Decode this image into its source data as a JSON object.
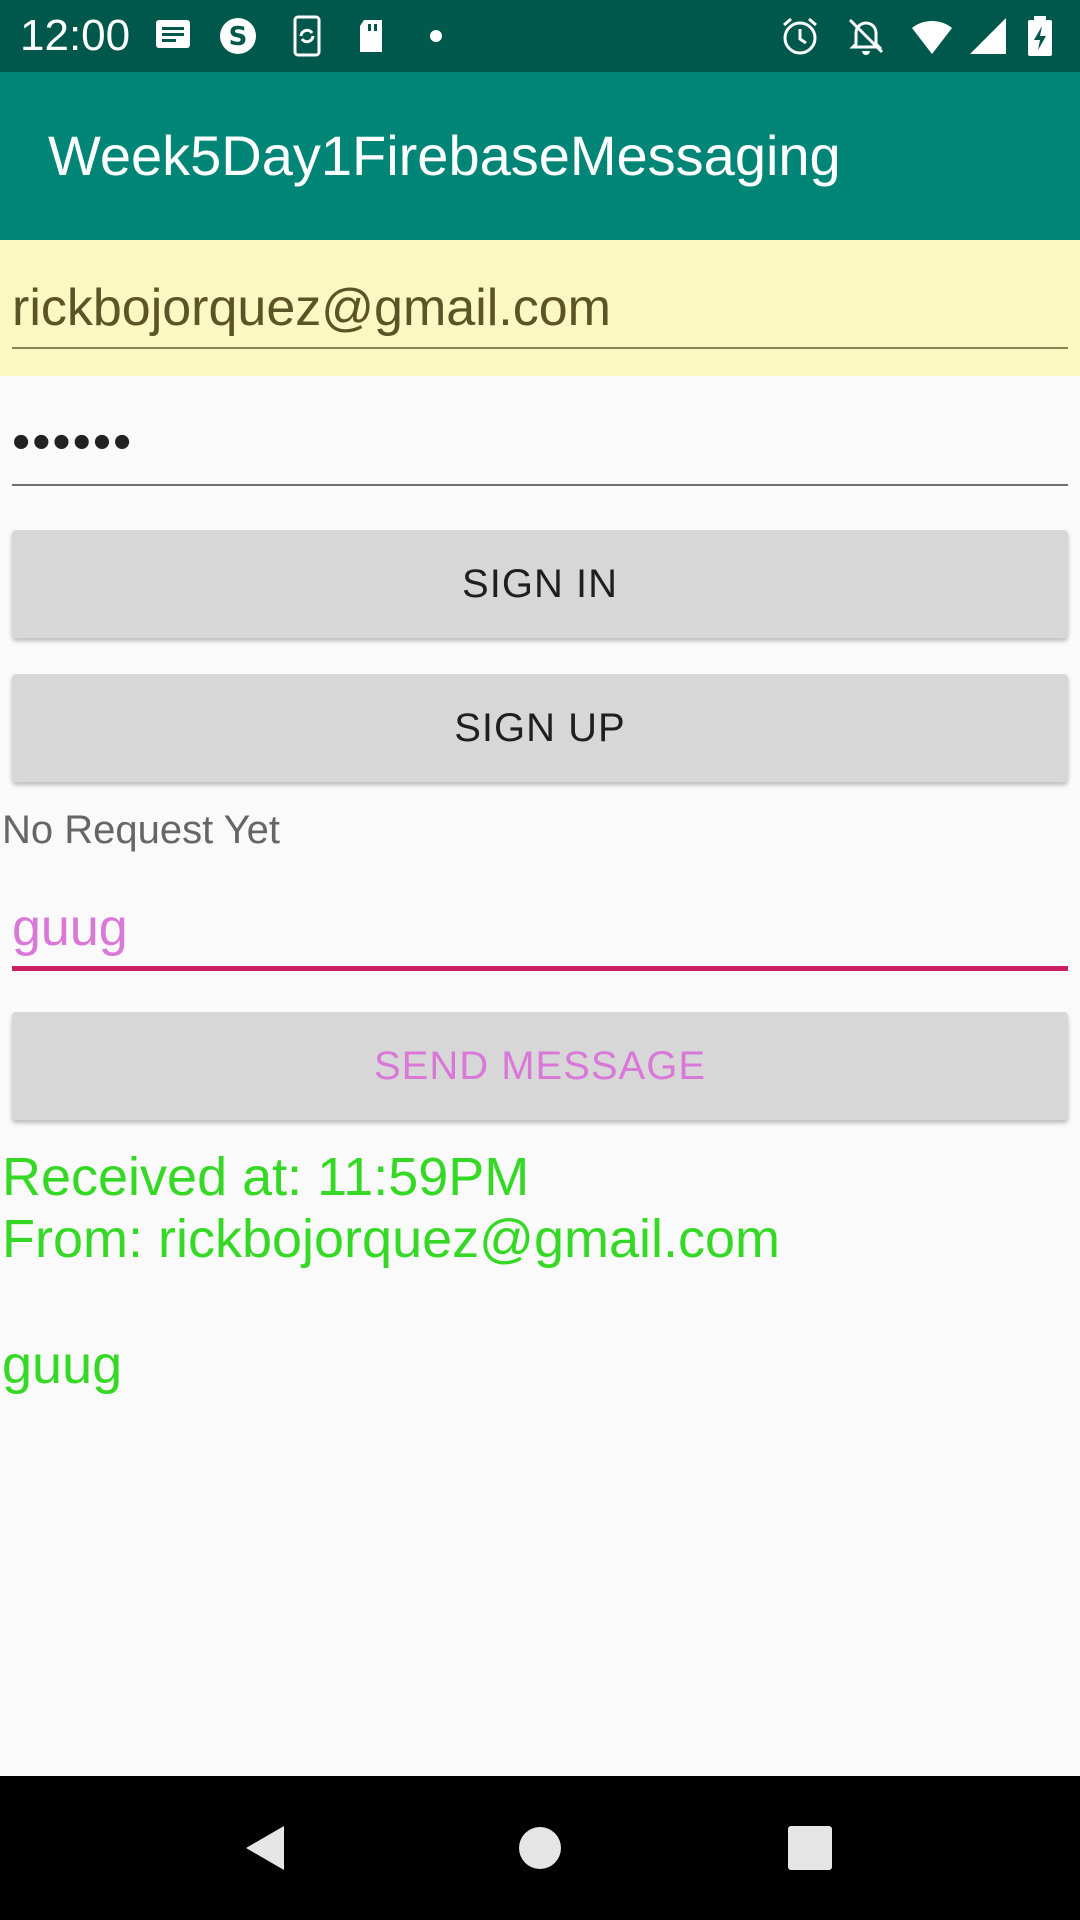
{
  "status_bar": {
    "time": "12:00",
    "icons_left": [
      "message-icon",
      "skype-icon",
      "sync-phone-icon",
      "sd-card-icon",
      "dot-icon"
    ],
    "icons_right": [
      "alarm-icon",
      "notifications-off-icon",
      "wifi-icon",
      "signal-icon",
      "battery-charging-icon"
    ]
  },
  "app_bar": {
    "title": "Week5Day1FirebaseMessaging"
  },
  "form": {
    "email_value": "rickbojorquez@gmail.com",
    "password_value": "••••••",
    "sign_in_label": "SIGN IN",
    "sign_up_label": "SIGN UP",
    "request_status": "No Request Yet",
    "message_value": "guug",
    "send_label": "SEND MESSAGE"
  },
  "received": {
    "line1": "Received at: 11:59PM",
    "line2": "From: rickbojorquez@gmail.com",
    "body": "guug"
  },
  "colors": {
    "status_bar": "#00574b",
    "app_bar": "#008577",
    "accent": "#c91f63",
    "received_text": "#35d925",
    "message_text": "#d978d8"
  },
  "nav_bar": {
    "buttons": [
      "back-icon",
      "home-icon",
      "recents-icon"
    ]
  }
}
